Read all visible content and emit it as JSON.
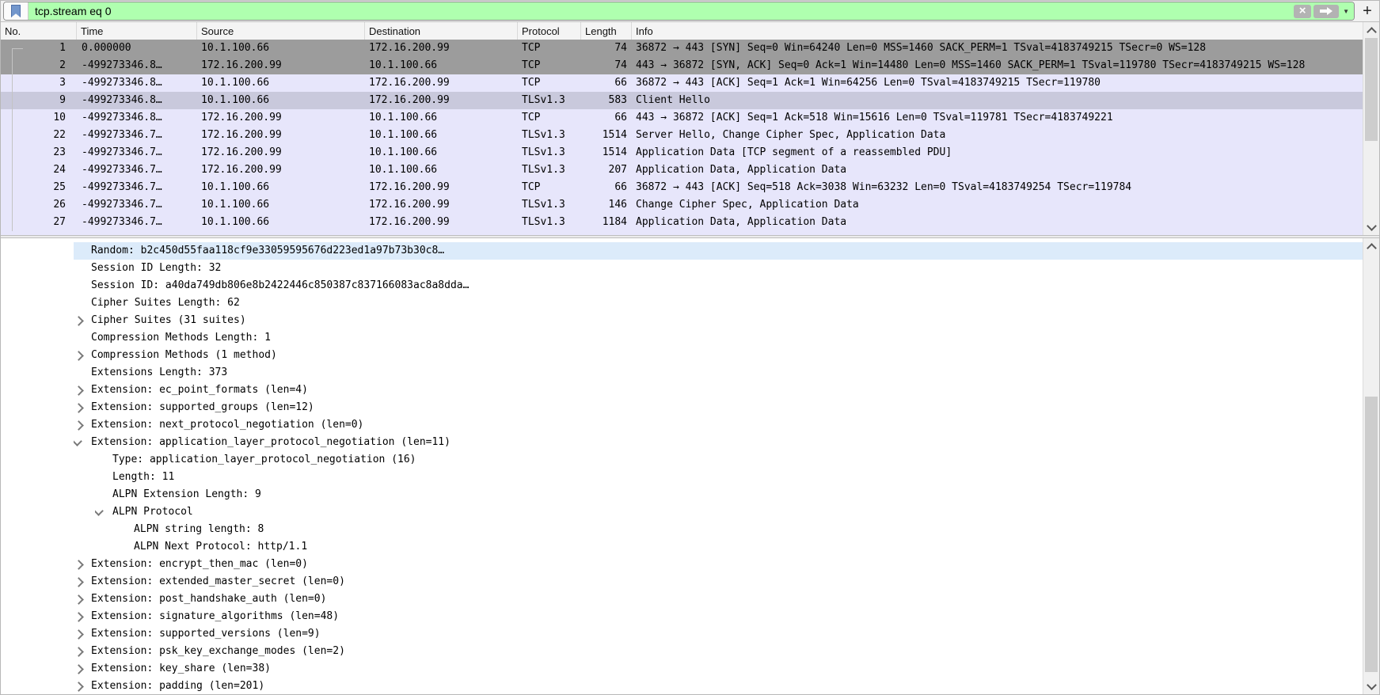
{
  "filter_bar": {
    "query": "tcp.stream eq 0",
    "add_button_label": "+",
    "clear_button_glyph": "×",
    "dropdown_glyph": "▼"
  },
  "colors": {
    "filter_valid_bg": "#afffaf",
    "row_gray_bg": "#9c9c9c",
    "row_lavender_bg": "#e7e6fb",
    "row_selected_bg": "#c9c9dc",
    "detail_selected_bg": "#dcebfa",
    "bookmark_blue": "#7296cc"
  },
  "packet_list": {
    "columns": [
      {
        "label": "No."
      },
      {
        "label": "Time"
      },
      {
        "label": "Source"
      },
      {
        "label": "Destination"
      },
      {
        "label": "Protocol"
      },
      {
        "label": "Length"
      },
      {
        "label": "Info"
      }
    ],
    "rows": [
      {
        "no": "1",
        "time": "0.000000",
        "source": "10.1.100.66",
        "destination": "172.16.200.99",
        "protocol": "TCP",
        "length": "74",
        "info": "36872 → 443 [SYN] Seq=0 Win=64240 Len=0 MSS=1460 SACK_PERM=1 TSval=4183749215 TSecr=0 WS=128",
        "color": "gray",
        "bracket": "start"
      },
      {
        "no": "2",
        "time": "-499273346.8…",
        "source": "172.16.200.99",
        "destination": "10.1.100.66",
        "protocol": "TCP",
        "length": "74",
        "info": "443 → 36872 [SYN, ACK] Seq=0 Ack=1 Win=14480 Len=0 MSS=1460 SACK_PERM=1 TSval=119780 TSecr=4183749215 WS=128",
        "color": "gray",
        "bracket": "cont"
      },
      {
        "no": "3",
        "time": "-499273346.8…",
        "source": "10.1.100.66",
        "destination": "172.16.200.99",
        "protocol": "TCP",
        "length": "66",
        "info": "36872 → 443 [ACK] Seq=1 Ack=1 Win=64256 Len=0 TSval=4183749215 TSecr=119780",
        "color": "lavender",
        "bracket": "cont"
      },
      {
        "no": "9",
        "time": "-499273346.8…",
        "source": "10.1.100.66",
        "destination": "172.16.200.99",
        "protocol": "TLSv1.3",
        "length": "583",
        "info": "Client Hello",
        "color": "selected",
        "bracket": "cont"
      },
      {
        "no": "10",
        "time": "-499273346.8…",
        "source": "172.16.200.99",
        "destination": "10.1.100.66",
        "protocol": "TCP",
        "length": "66",
        "info": "443 → 36872 [ACK] Seq=1 Ack=518 Win=15616 Len=0 TSval=119781 TSecr=4183749221",
        "color": "lavender",
        "bracket": "cont"
      },
      {
        "no": "22",
        "time": "-499273346.7…",
        "source": "172.16.200.99",
        "destination": "10.1.100.66",
        "protocol": "TLSv1.3",
        "length": "1514",
        "info": "Server Hello, Change Cipher Spec, Application Data",
        "color": "lavender",
        "bracket": "cont"
      },
      {
        "no": "23",
        "time": "-499273346.7…",
        "source": "172.16.200.99",
        "destination": "10.1.100.66",
        "protocol": "TLSv1.3",
        "length": "1514",
        "info": "Application Data [TCP segment of a reassembled PDU]",
        "color": "lavender",
        "bracket": "cont"
      },
      {
        "no": "24",
        "time": "-499273346.7…",
        "source": "172.16.200.99",
        "destination": "10.1.100.66",
        "protocol": "TLSv1.3",
        "length": "207",
        "info": "Application Data, Application Data",
        "color": "lavender",
        "bracket": "cont"
      },
      {
        "no": "25",
        "time": "-499273346.7…",
        "source": "10.1.100.66",
        "destination": "172.16.200.99",
        "protocol": "TCP",
        "length": "66",
        "info": "36872 → 443 [ACK] Seq=518 Ack=3038 Win=63232 Len=0 TSval=4183749254 TSecr=119784",
        "color": "lavender",
        "bracket": "cont"
      },
      {
        "no": "26",
        "time": "-499273346.7…",
        "source": "10.1.100.66",
        "destination": "172.16.200.99",
        "protocol": "TLSv1.3",
        "length": "146",
        "info": "Change Cipher Spec, Application Data",
        "color": "lavender",
        "bracket": "cont"
      },
      {
        "no": "27",
        "time": "-499273346.7…",
        "source": "10.1.100.66",
        "destination": "172.16.200.99",
        "protocol": "TLSv1.3",
        "length": "1184",
        "info": "Application Data, Application Data",
        "color": "lavender",
        "bracket": "cont"
      }
    ]
  },
  "detail_tree": {
    "lines": [
      {
        "indent": 0,
        "arrow": "none",
        "text": "Random: b2c450d55faa118cf9e33059595676d223ed1a97b73b30c8…",
        "selected": true
      },
      {
        "indent": 0,
        "arrow": "none",
        "text": "Session ID Length: 32"
      },
      {
        "indent": 0,
        "arrow": "none",
        "text": "Session ID: a40da749db806e8b2422446c850387c837166083ac8a8dda…"
      },
      {
        "indent": 0,
        "arrow": "none",
        "text": "Cipher Suites Length: 62"
      },
      {
        "indent": 0,
        "arrow": "collapsed",
        "text": "Cipher Suites (31 suites)"
      },
      {
        "indent": 0,
        "arrow": "none",
        "text": "Compression Methods Length: 1"
      },
      {
        "indent": 0,
        "arrow": "collapsed",
        "text": "Compression Methods (1 method)"
      },
      {
        "indent": 0,
        "arrow": "none",
        "text": "Extensions Length: 373"
      },
      {
        "indent": 0,
        "arrow": "collapsed",
        "text": "Extension: ec_point_formats (len=4)"
      },
      {
        "indent": 0,
        "arrow": "collapsed",
        "text": "Extension: supported_groups (len=12)"
      },
      {
        "indent": 0,
        "arrow": "collapsed",
        "text": "Extension: next_protocol_negotiation (len=0)"
      },
      {
        "indent": 0,
        "arrow": "expanded",
        "text": "Extension: application_layer_protocol_negotiation (len=11)"
      },
      {
        "indent": 1,
        "arrow": "none",
        "text": "Type: application_layer_protocol_negotiation (16)"
      },
      {
        "indent": 1,
        "arrow": "none",
        "text": "Length: 11"
      },
      {
        "indent": 1,
        "arrow": "none",
        "text": "ALPN Extension Length: 9"
      },
      {
        "indent": 1,
        "arrow": "expanded",
        "text": "ALPN Protocol"
      },
      {
        "indent": 2,
        "arrow": "none",
        "text": "ALPN string length: 8"
      },
      {
        "indent": 2,
        "arrow": "none",
        "text": "ALPN Next Protocol: http/1.1"
      },
      {
        "indent": 0,
        "arrow": "collapsed",
        "text": "Extension: encrypt_then_mac (len=0)"
      },
      {
        "indent": 0,
        "arrow": "collapsed",
        "text": "Extension: extended_master_secret (len=0)"
      },
      {
        "indent": 0,
        "arrow": "collapsed",
        "text": "Extension: post_handshake_auth (len=0)"
      },
      {
        "indent": 0,
        "arrow": "collapsed",
        "text": "Extension: signature_algorithms (len=48)"
      },
      {
        "indent": 0,
        "arrow": "collapsed",
        "text": "Extension: supported_versions (len=9)"
      },
      {
        "indent": 0,
        "arrow": "collapsed",
        "text": "Extension: psk_key_exchange_modes (len=2)"
      },
      {
        "indent": 0,
        "arrow": "collapsed",
        "text": "Extension: key_share (len=38)"
      },
      {
        "indent": 0,
        "arrow": "collapsed",
        "text": "Extension: padding (len=201)"
      }
    ]
  }
}
